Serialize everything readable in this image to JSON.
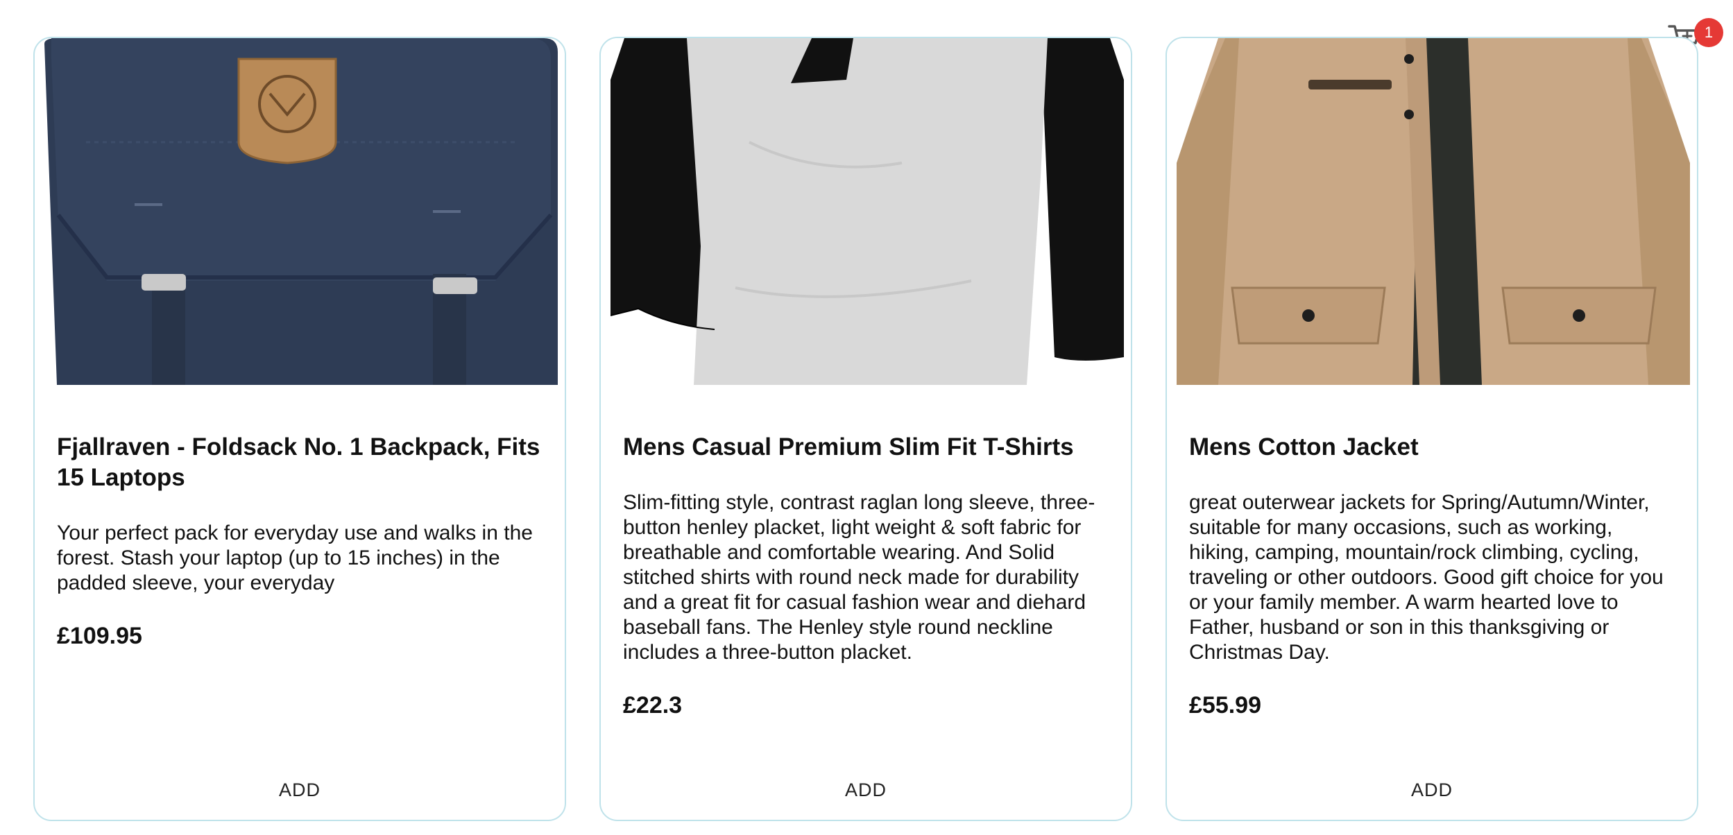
{
  "cart": {
    "icon": "cart-icon",
    "count": "1",
    "badge_color": "#e53935"
  },
  "colors": {
    "card_border": "#bfe2ea"
  },
  "products": [
    {
      "image_icon": "backpack-image",
      "title": "Fjallraven - Foldsack No. 1 Backpack, Fits 15 Laptops",
      "description": "Your perfect pack for everyday use and walks in the forest. Stash your laptop (up to 15 inches) in the padded sleeve, your everyday",
      "price": "£109.95",
      "add_label": "ADD"
    },
    {
      "image_icon": "tshirt-image",
      "title": "Mens Casual Premium Slim Fit T-Shirts",
      "description": "Slim-fitting style, contrast raglan long sleeve, three-button henley placket, light weight & soft fabric for breathable and comfortable wearing. And Solid stitched shirts with round neck made for durability and a great fit for casual fashion wear and diehard baseball fans. The Henley style round neckline includes a three-button placket.",
      "price": "£22.3",
      "add_label": "ADD"
    },
    {
      "image_icon": "jacket-image",
      "title": "Mens Cotton Jacket",
      "description": "great outerwear jackets for Spring/Autumn/Winter, suitable for many occasions, such as working, hiking, camping, mountain/rock climbing, cycling, traveling or other outdoors. Good gift choice for you or your family member. A warm hearted love to Father, husband or son in this thanksgiving or Christmas Day.",
      "price": "£55.99",
      "add_label": "ADD"
    }
  ]
}
